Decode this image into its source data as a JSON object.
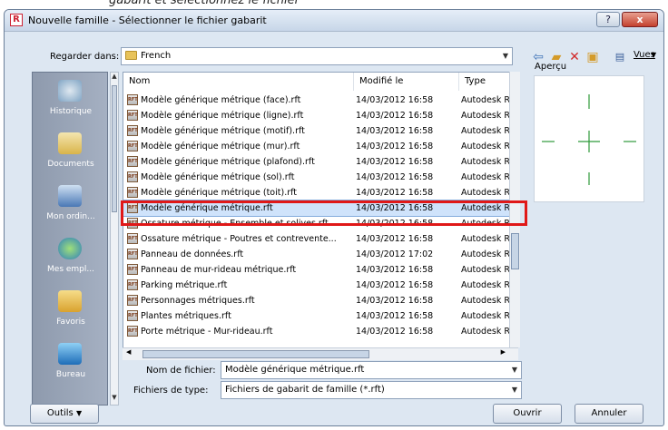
{
  "caption": "gabarit et sélectionnez le fichier",
  "window": {
    "title": "Nouvelle famille - Sélectionner le fichier gabarit",
    "app_icon": "R",
    "help_label": "?",
    "close_label": "x"
  },
  "look_in": {
    "label": "Regarder dans:",
    "value": "French"
  },
  "toolbar": {
    "icons": [
      "back-arrow-icon",
      "up-folder-icon",
      "delete-icon",
      "new-folder-icon"
    ],
    "views_label": "Vues"
  },
  "places": [
    {
      "label": "Historique",
      "icon": "history-icon"
    },
    {
      "label": "Documents",
      "icon": "documents-icon"
    },
    {
      "label": "Mon ordin...",
      "icon": "computer-icon"
    },
    {
      "label": "Mes empl...",
      "icon": "network-icon"
    },
    {
      "label": "Favoris",
      "icon": "favorites-icon"
    },
    {
      "label": "Bureau",
      "icon": "desktop-icon"
    }
  ],
  "columns": {
    "name": "Nom",
    "date": "Modifié le",
    "type": "Type"
  },
  "files": [
    {
      "name": "Modèle générique métrique (face).rft",
      "date": "14/03/2012 16:58",
      "type": "Autodesk R"
    },
    {
      "name": "Modèle générique métrique (ligne).rft",
      "date": "14/03/2012 16:58",
      "type": "Autodesk R"
    },
    {
      "name": "Modèle générique métrique (motif).rft",
      "date": "14/03/2012 16:58",
      "type": "Autodesk R"
    },
    {
      "name": "Modèle générique métrique (mur).rft",
      "date": "14/03/2012 16:58",
      "type": "Autodesk R"
    },
    {
      "name": "Modèle générique métrique (plafond).rft",
      "date": "14/03/2012 16:58",
      "type": "Autodesk R"
    },
    {
      "name": "Modèle générique métrique (sol).rft",
      "date": "14/03/2012 16:58",
      "type": "Autodesk R"
    },
    {
      "name": "Modèle générique métrique (toit).rft",
      "date": "14/03/2012 16:58",
      "type": "Autodesk R"
    },
    {
      "name": "Modèle générique métrique.rft",
      "date": "14/03/2012 16:58",
      "type": "Autodesk R"
    },
    {
      "name": "Ossature métrique - Ensemble et solives.rft",
      "date": "14/03/2012 16:58",
      "type": "Autodesk R"
    },
    {
      "name": "Ossature métrique - Poutres et contrevente...",
      "date": "14/03/2012 16:58",
      "type": "Autodesk R"
    },
    {
      "name": "Panneau de données.rft",
      "date": "14/03/2012 17:02",
      "type": "Autodesk R"
    },
    {
      "name": "Panneau de mur-rideau métrique.rft",
      "date": "14/03/2012 16:58",
      "type": "Autodesk R"
    },
    {
      "name": "Parking métrique.rft",
      "date": "14/03/2012 16:58",
      "type": "Autodesk R"
    },
    {
      "name": "Personnages métriques.rft",
      "date": "14/03/2012 16:58",
      "type": "Autodesk R"
    },
    {
      "name": "Plantes métriques.rft",
      "date": "14/03/2012 16:58",
      "type": "Autodesk R"
    },
    {
      "name": "Porte métrique - Mur-rideau.rft",
      "date": "14/03/2012 16:58",
      "type": "Autodesk R"
    }
  ],
  "file_icon_text": "RFT",
  "preview_label": "Aperçu",
  "filename": {
    "label": "Nom de fichier:",
    "value": "Modèle générique métrique.rft"
  },
  "filetype": {
    "label": "Fichiers de type:",
    "value": "Fichiers de gabarit de famille  (*.rft)"
  },
  "buttons": {
    "tools": "Outils",
    "open": "Ouvrir",
    "cancel": "Annuler"
  },
  "colors": {
    "highlight": "#e01818",
    "preview_cross": "#2f9a3a",
    "selection": "#cfe3fb"
  }
}
